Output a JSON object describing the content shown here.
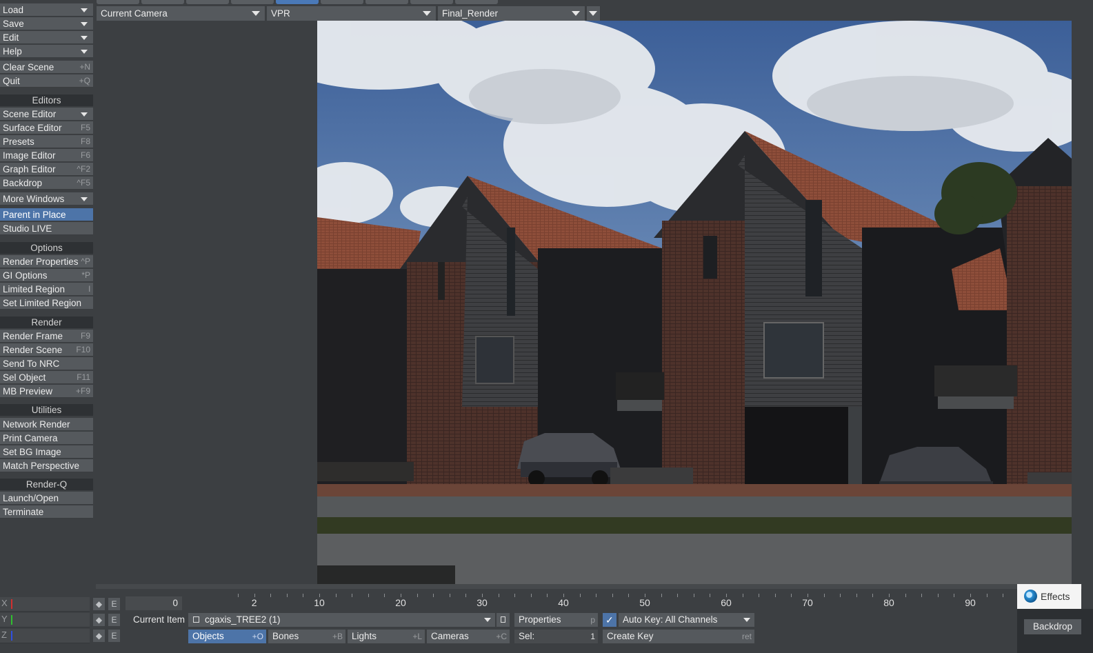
{
  "toolbar": {
    "load": "Load",
    "save": "Save",
    "edit": "Edit",
    "help": "Help",
    "clear_scene": "Clear Scene",
    "clear_scene_sc": "+N",
    "quit": "Quit",
    "quit_sc": "+Q",
    "editors_head": "Editors",
    "scene_editor": "Scene Editor",
    "surface_editor": "Surface Editor",
    "surface_editor_sc": "F5",
    "presets": "Presets",
    "presets_sc": "F8",
    "image_editor": "Image Editor",
    "image_editor_sc": "F6",
    "graph_editor": "Graph Editor",
    "graph_editor_sc": "^F2",
    "backdrop": "Backdrop",
    "backdrop_sc": "^F5",
    "more_windows": "More Windows",
    "parent_in_place": "Parent in Place",
    "studio_live": "Studio LIVE",
    "options_head": "Options",
    "render_properties": "Render Properties",
    "render_properties_sc": "^P",
    "gi_options": "GI Options",
    "gi_options_sc": "*P",
    "limited_region": "Limited Region",
    "limited_region_sc": "l",
    "set_limited_region": "Set Limited Region",
    "render_head": "Render",
    "render_frame": "Render Frame",
    "render_frame_sc": "F9",
    "render_scene": "Render Scene",
    "render_scene_sc": "F10",
    "send_to_nrc": "Send To NRC",
    "sel_object": "Sel Object",
    "sel_object_sc": "F11",
    "mb_preview": "MB Preview",
    "mb_preview_sc": "+F9",
    "utilities_head": "Utilities",
    "network_render": "Network Render",
    "print_camera": "Print Camera",
    "set_bg_image": "Set BG Image",
    "match_perspective": "Match Perspective",
    "renderq_head": "Render-Q",
    "launch_open": "Launch/Open",
    "terminate": "Terminate"
  },
  "viewport": {
    "camera": "Current Camera",
    "mode": "VPR",
    "preset": "Final_Render"
  },
  "timeline": {
    "current_frame": "0",
    "ticks": [
      "2",
      "10",
      "20",
      "30",
      "40",
      "50",
      "60",
      "70",
      "80",
      "90"
    ]
  },
  "axes": [
    "X",
    "Y",
    "Z"
  ],
  "axis_colors": {
    "x": "#d23030",
    "y": "#30c030",
    "z": "#3050e0"
  },
  "bottom": {
    "current_item_label": "Current Item",
    "current_item": "cgaxis_TREE2 (1)",
    "properties": "Properties",
    "properties_sc": "p",
    "auto_key": "Auto Key: All Channels",
    "objects": "Objects",
    "objects_sc": "+O",
    "bones": "Bones",
    "bones_sc": "+B",
    "lights": "Lights",
    "lights_sc": "+L",
    "cameras": "Cameras",
    "cameras_sc": "+C",
    "sel_label": "Sel:",
    "sel_value": "1",
    "create_key": "Create Key",
    "create_key_sc": "ret",
    "e_label": "E"
  },
  "popup": {
    "effects": "Effects",
    "backdrop": "Backdrop"
  },
  "colors": {
    "accent": "#4d74a8",
    "panel": "#55595d",
    "background": "#3c3f42"
  }
}
